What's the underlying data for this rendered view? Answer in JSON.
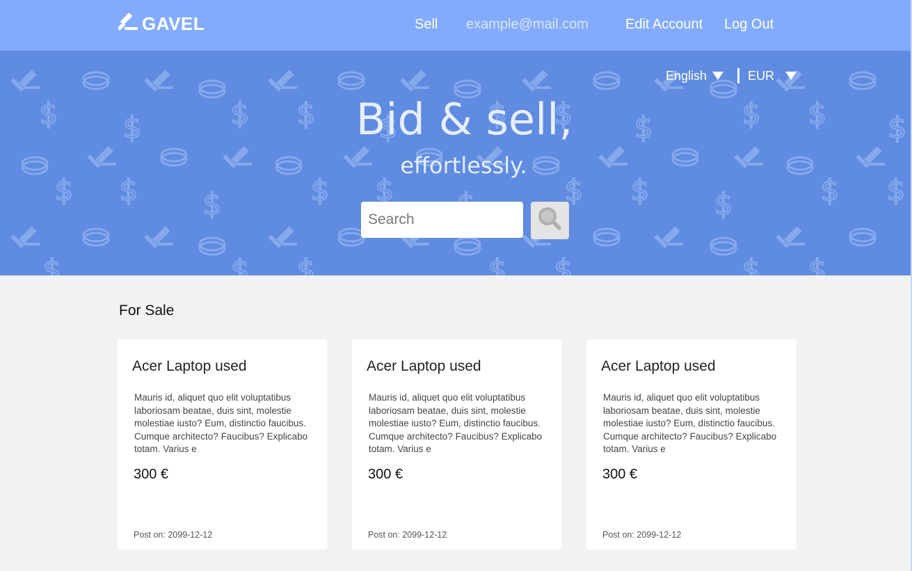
{
  "header": {
    "logo_text": "GAVEL",
    "nav": {
      "sell": "Sell",
      "email": "example@mail.com",
      "edit_account": "Edit Account",
      "log_out": "Log Out"
    }
  },
  "hero": {
    "language": "English",
    "currency": "EUR",
    "title": "Bid & sell,",
    "subtitle": "effortlessly.",
    "search_placeholder": "Search"
  },
  "listings": {
    "section_title": "For Sale",
    "items": [
      {
        "title": "Acer Laptop used",
        "description": "Mauris id, aliquet quo elit voluptatibus laboriosam beatae, duis sint, molestie molestiae iusto? Eum, distinctio faucibus. Cumque architecto? Faucibus? Explicabo totam. Varius e",
        "price": "300 €",
        "posted": "Post on: 2099-12-12"
      },
      {
        "title": "Acer Laptop used",
        "description": "Mauris id, aliquet quo elit voluptatibus laboriosam beatae, duis sint, molestie molestiae iusto? Eum, distinctio faucibus. Cumque architecto? Faucibus? Explicabo totam. Varius e",
        "price": "300 €",
        "posted": "Post on: 2099-12-12"
      },
      {
        "title": "Acer Laptop used",
        "description": "Mauris id, aliquet quo elit voluptatibus laboriosam beatae, duis sint, molestie molestiae iusto? Eum, distinctio faucibus. Cumque architecto? Faucibus? Explicabo totam. Varius e",
        "price": "300 €",
        "posted": "Post on: 2099-12-12"
      }
    ]
  },
  "colors": {
    "header_bg": "#82abfd",
    "hero_bg": "#5f8be0",
    "page_bg": "#f2f2f2",
    "card_bg": "#ffffff"
  },
  "icons": {
    "logo": "gavel-icon",
    "search": "search-icon",
    "dropdown": "caret-down-icon",
    "pattern": [
      "gavel-icon",
      "coin-icon",
      "dollar-icon"
    ]
  }
}
